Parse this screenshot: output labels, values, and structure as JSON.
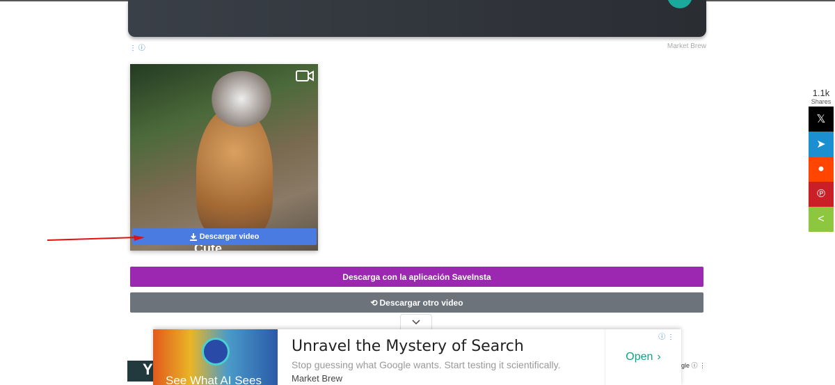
{
  "top_ad": {
    "info_icons": "⋮ ⓘ",
    "advertiser": "Market Brew"
  },
  "media": {
    "caption": "Cute",
    "download_label": "Descargar video"
  },
  "buttons": {
    "app_download": "Descarga con la aplicación SaveInsta",
    "download_another": "Descargar otro video"
  },
  "share": {
    "count": "1.1k",
    "label": "Shares",
    "items": [
      {
        "network": "x",
        "glyph": "𝕏",
        "color": "#000000"
      },
      {
        "network": "telegram",
        "glyph": "➤",
        "color": "#1b8fd0"
      },
      {
        "network": "reddit",
        "glyph": "●",
        "color": "#ff4500"
      },
      {
        "network": "pinterest",
        "glyph": "℗",
        "color": "#cb1f27"
      },
      {
        "network": "share",
        "glyph": "<",
        "color": "#8dc63f"
      }
    ]
  },
  "bottom_ad": {
    "image_text": "See What AI Sees",
    "title": "Unravel the Mystery of Search",
    "description": "Stop guessing what Google wants. Start testing it scientifically.",
    "advertiser": "Market Brew",
    "cta": "Open",
    "info": "ⓘ ⋮",
    "left_partial": "Y",
    "right_partial": "gle ⓘ ⋮"
  }
}
